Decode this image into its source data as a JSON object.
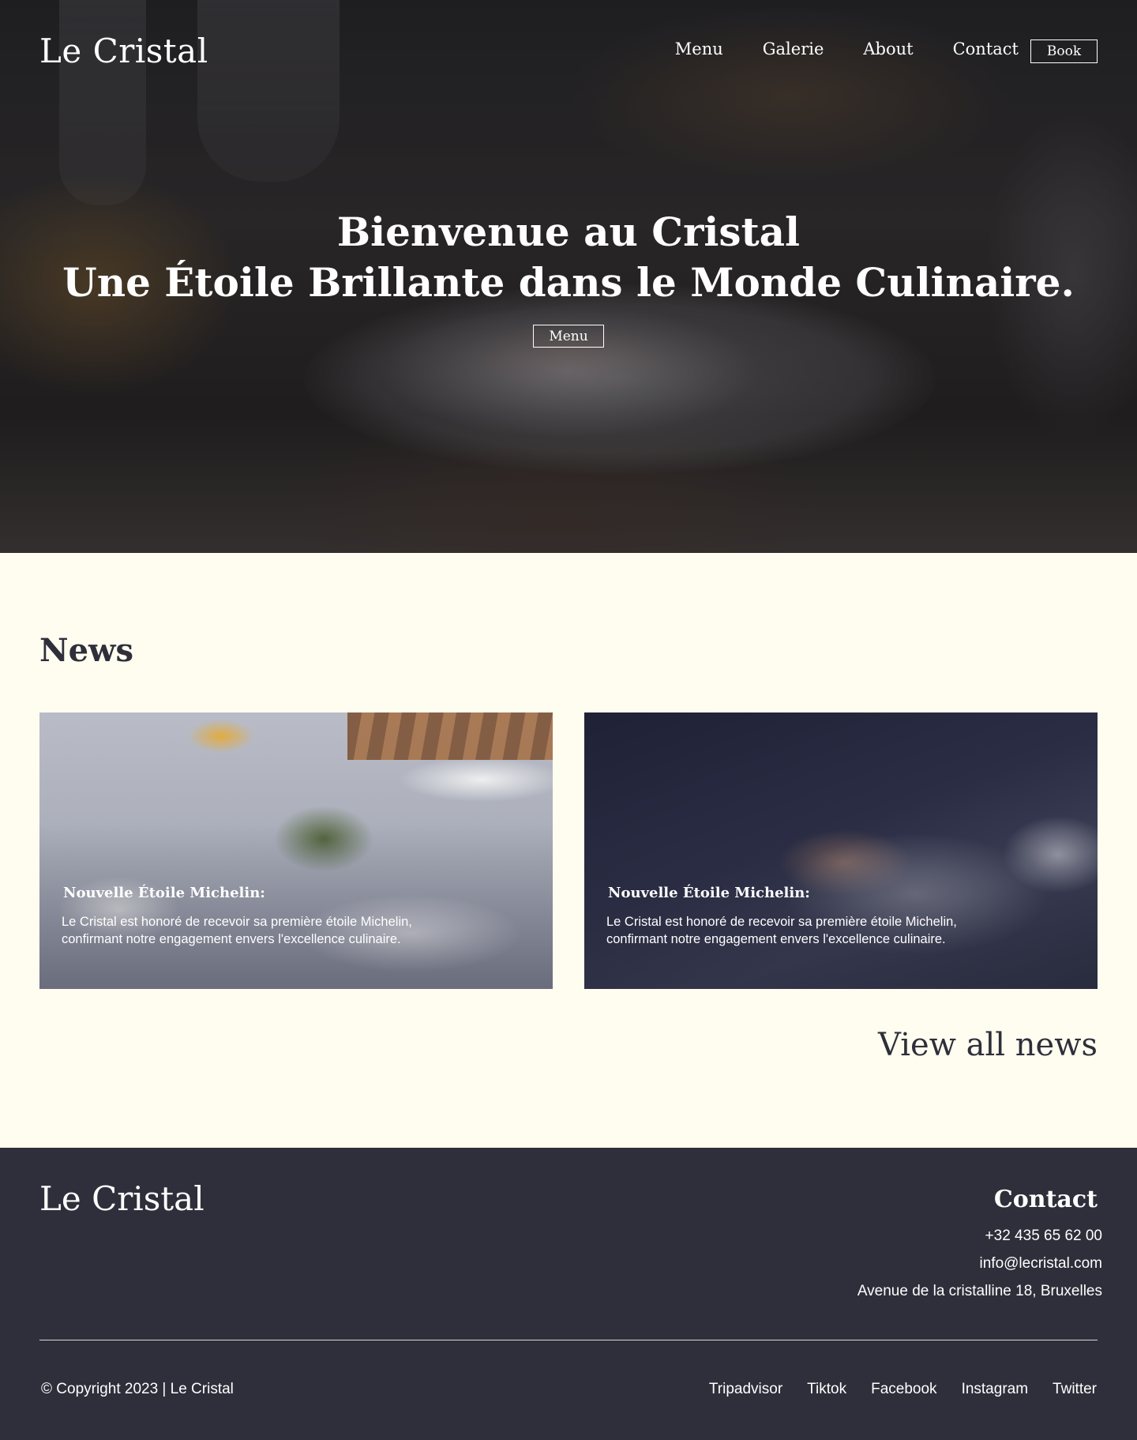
{
  "nav": {
    "logo": "Le Cristal",
    "links": [
      {
        "label": "Menu"
      },
      {
        "label": "Galerie"
      },
      {
        "label": "About"
      },
      {
        "label": "Contact"
      }
    ],
    "book_label": "Book"
  },
  "hero": {
    "title_line1": "Bienvenue au Cristal",
    "title_line2": "Une Étoile Brillante dans le Monde Culinaire.",
    "button_label": "Menu"
  },
  "news": {
    "heading": "News",
    "cards": [
      {
        "title": "Nouvelle Étoile Michelin:",
        "text": "Le Cristal est honoré de recevoir sa première étoile Michelin, confirmant notre engagement envers l'excellence culinaire."
      },
      {
        "title": "Nouvelle Étoile Michelin:",
        "text": "Le Cristal est honoré de recevoir sa première étoile Michelin, confirmant notre engagement envers l'excellence culinaire."
      }
    ],
    "view_all": "View all news"
  },
  "footer": {
    "logo": "Le Cristal",
    "contact_heading": "Contact",
    "phone": "+32 435 65 62 00",
    "email": "info@lecristal.com",
    "address": "Avenue de la cristalline 18, Bruxelles",
    "copyright": "© Copyright 2023 | Le Cristal",
    "socials": [
      {
        "label": "Tripadvisor"
      },
      {
        "label": "Tiktok"
      },
      {
        "label": "Facebook"
      },
      {
        "label": "Instagram"
      },
      {
        "label": "Twitter"
      }
    ]
  },
  "colors": {
    "background": "#fffdf0",
    "footer": "#2e2f3a",
    "text_dark": "#2e2f3a",
    "text_light": "#ffffff"
  }
}
